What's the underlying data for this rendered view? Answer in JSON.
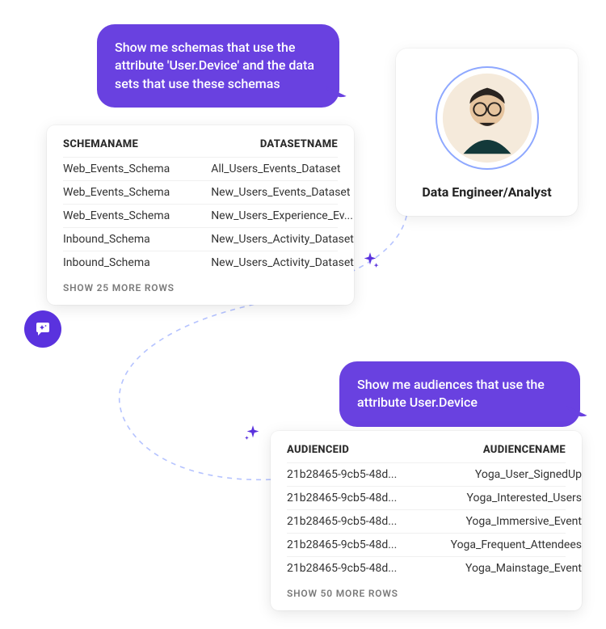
{
  "bubble1": {
    "text": "Show me schemas that use the attribute 'User.Device' and the data sets that use these schemas"
  },
  "persona": {
    "title": "Data Engineer/Analyst"
  },
  "card1": {
    "head_left": "SCHEMANAME",
    "head_right": "DATASETNAME",
    "rows": [
      {
        "l": "Web_Events_Schema",
        "r": "All_Users_Events_Dataset"
      },
      {
        "l": "Web_Events_Schema",
        "r": "New_Users_Events_Dataset"
      },
      {
        "l": "Web_Events_Schema",
        "r": "New_Users_Experience_Ev..."
      },
      {
        "l": "Inbound_Schema",
        "r": "New_Users_Activity_Dataset"
      },
      {
        "l": "Inbound_Schema",
        "r": "New_Users_Activity_Dataset"
      }
    ],
    "footer": "SHOW 25 MORE ROWS"
  },
  "bubble2": {
    "text": "Show me audiences that use the attribute User.Device"
  },
  "card2": {
    "head_left": "AUDIENCEID",
    "head_right": "AUDIENCENAME",
    "rows": [
      {
        "l": "21b28465-9cb5-48d...",
        "r": "Yoga_User_SignedUp"
      },
      {
        "l": "21b28465-9cb5-48d...",
        "r": "Yoga_Interested_Users"
      },
      {
        "l": "21b28465-9cb5-48d...",
        "r": "Yoga_Immersive_Event"
      },
      {
        "l": "21b28465-9cb5-48d...",
        "r": "Yoga_Frequent_Attendees"
      },
      {
        "l": "21b28465-9cb5-48d...",
        "r": "Yoga_Mainstage_Event"
      }
    ],
    "footer": "SHOW 50 MORE ROWS"
  }
}
